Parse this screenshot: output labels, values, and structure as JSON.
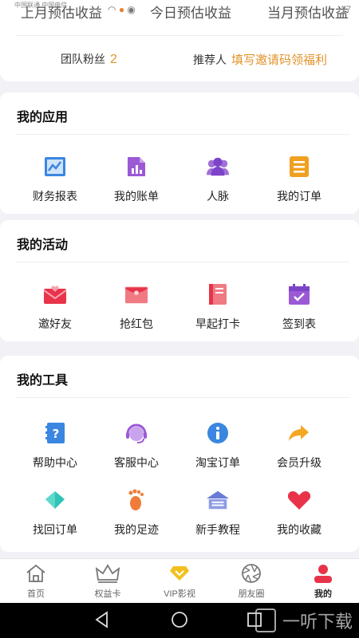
{
  "status_bar": {
    "carrier": "中国联通 中国电信",
    "clock": "17",
    "ghost_text": [
      "上月预估收益",
      "今日预估收益",
      "当月预估收益"
    ]
  },
  "team": {
    "fans_label": "团队粉丝",
    "fans_count": "2",
    "referrer_label": "推荐人",
    "invite_text": "填写邀请码领福利"
  },
  "apps": {
    "title": "我的应用",
    "items": [
      {
        "label": "财务报表",
        "icon": "finance-report-icon"
      },
      {
        "label": "我的账单",
        "icon": "bill-icon"
      },
      {
        "label": "人脉",
        "icon": "contacts-icon"
      },
      {
        "label": "我的订单",
        "icon": "order-icon"
      }
    ]
  },
  "activities": {
    "title": "我的活动",
    "items": [
      {
        "label": "邀好友",
        "icon": "invite-friend-icon"
      },
      {
        "label": "抢红包",
        "icon": "red-packet-icon"
      },
      {
        "label": "早起打卡",
        "icon": "early-checkin-icon"
      },
      {
        "label": "签到表",
        "icon": "sign-in-calendar-icon"
      }
    ]
  },
  "tools": {
    "title": "我的工具",
    "items": [
      {
        "label": "帮助中心",
        "icon": "help-icon"
      },
      {
        "label": "客服中心",
        "icon": "customer-service-icon"
      },
      {
        "label": "淘宝订单",
        "icon": "info-icon"
      },
      {
        "label": "会员升级",
        "icon": "share-arrow-icon"
      },
      {
        "label": "找回订单",
        "icon": "diamond-icon"
      },
      {
        "label": "我的足迹",
        "icon": "footprint-icon"
      },
      {
        "label": "新手教程",
        "icon": "tutorial-icon"
      },
      {
        "label": "我的收藏",
        "icon": "heart-icon"
      }
    ]
  },
  "tab_bar": [
    {
      "label": "首页",
      "icon": "home-icon"
    },
    {
      "label": "权益卡",
      "icon": "crown-icon"
    },
    {
      "label": "VIP影视",
      "icon": "vip-diamond-icon"
    },
    {
      "label": "朋友圈",
      "icon": "aperture-icon"
    },
    {
      "label": "我的",
      "icon": "profile-icon",
      "active": true
    }
  ],
  "watermark": "一听下载",
  "colors": {
    "accent_orange": "#e2932b",
    "active_red": "#e8334a",
    "background": "#f2f2f6"
  }
}
